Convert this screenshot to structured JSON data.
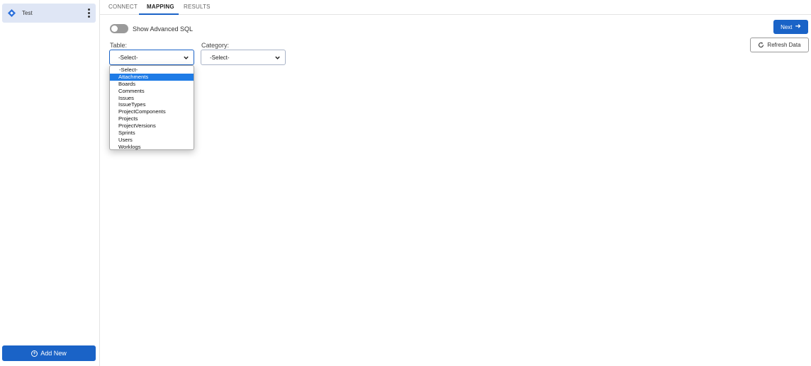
{
  "sidebar": {
    "connection": {
      "label": "Test",
      "icon": "jira-diamond-icon",
      "icon_color": "#2a6fdb"
    },
    "add_new_label": "Add New",
    "add_new_icon": "plus-circle-icon"
  },
  "tabs": [
    {
      "label": "CONNECT",
      "active": false
    },
    {
      "label": "MAPPING",
      "active": true
    },
    {
      "label": "RESULTS",
      "active": false
    }
  ],
  "toggle": {
    "label": "Show Advanced SQL",
    "on": false
  },
  "table_field": {
    "label": "Table:",
    "value": "-Select-"
  },
  "category_field": {
    "label": "Category:",
    "value": "-Select-"
  },
  "table_options": [
    {
      "label": "-Select-",
      "selected": false
    },
    {
      "label": "Attachments",
      "selected": true
    },
    {
      "label": "Boards",
      "selected": false
    },
    {
      "label": "Comments",
      "selected": false
    },
    {
      "label": "Issues",
      "selected": false
    },
    {
      "label": "IssueTypes",
      "selected": false
    },
    {
      "label": "ProjectComponents",
      "selected": false
    },
    {
      "label": "Projects",
      "selected": false
    },
    {
      "label": "ProjectVersions",
      "selected": false
    },
    {
      "label": "Sprints",
      "selected": false
    },
    {
      "label": "Users",
      "selected": false
    },
    {
      "label": "Worklogs",
      "selected": false
    }
  ],
  "buttons": {
    "next_label": "Next",
    "next_icon": "arrow-right-icon",
    "refresh_label": "Refresh Data",
    "refresh_icon": "refresh-icon"
  },
  "colors": {
    "accent": "#1a63c7",
    "selected_option": "#1e7be6"
  }
}
